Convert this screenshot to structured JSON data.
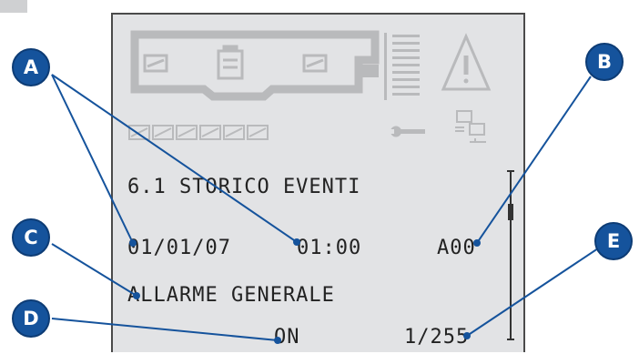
{
  "display": {
    "line1": "6.1 STORICO EVENTI",
    "line2_date": "01/01/07",
    "line2_time": "01:00",
    "line2_code": "A00",
    "line3": "ALLARME GENERALE",
    "line4_state": "ON",
    "line4_counter": "1/255"
  },
  "callouts": {
    "a": "A",
    "b": "B",
    "c": "C",
    "d": "D",
    "e": "E"
  },
  "colors": {
    "badge": "#15539c",
    "lcd_background": "#e2e3e5",
    "lcd_text": "#222222",
    "icons_faded": "#b9babc"
  },
  "icons": [
    "rectifier-icon",
    "battery-icon",
    "inverter-icon",
    "output-bars-icon",
    "alarm-warning-icon",
    "wrench-icon",
    "computer-network-icon",
    "module-status-icon"
  ]
}
